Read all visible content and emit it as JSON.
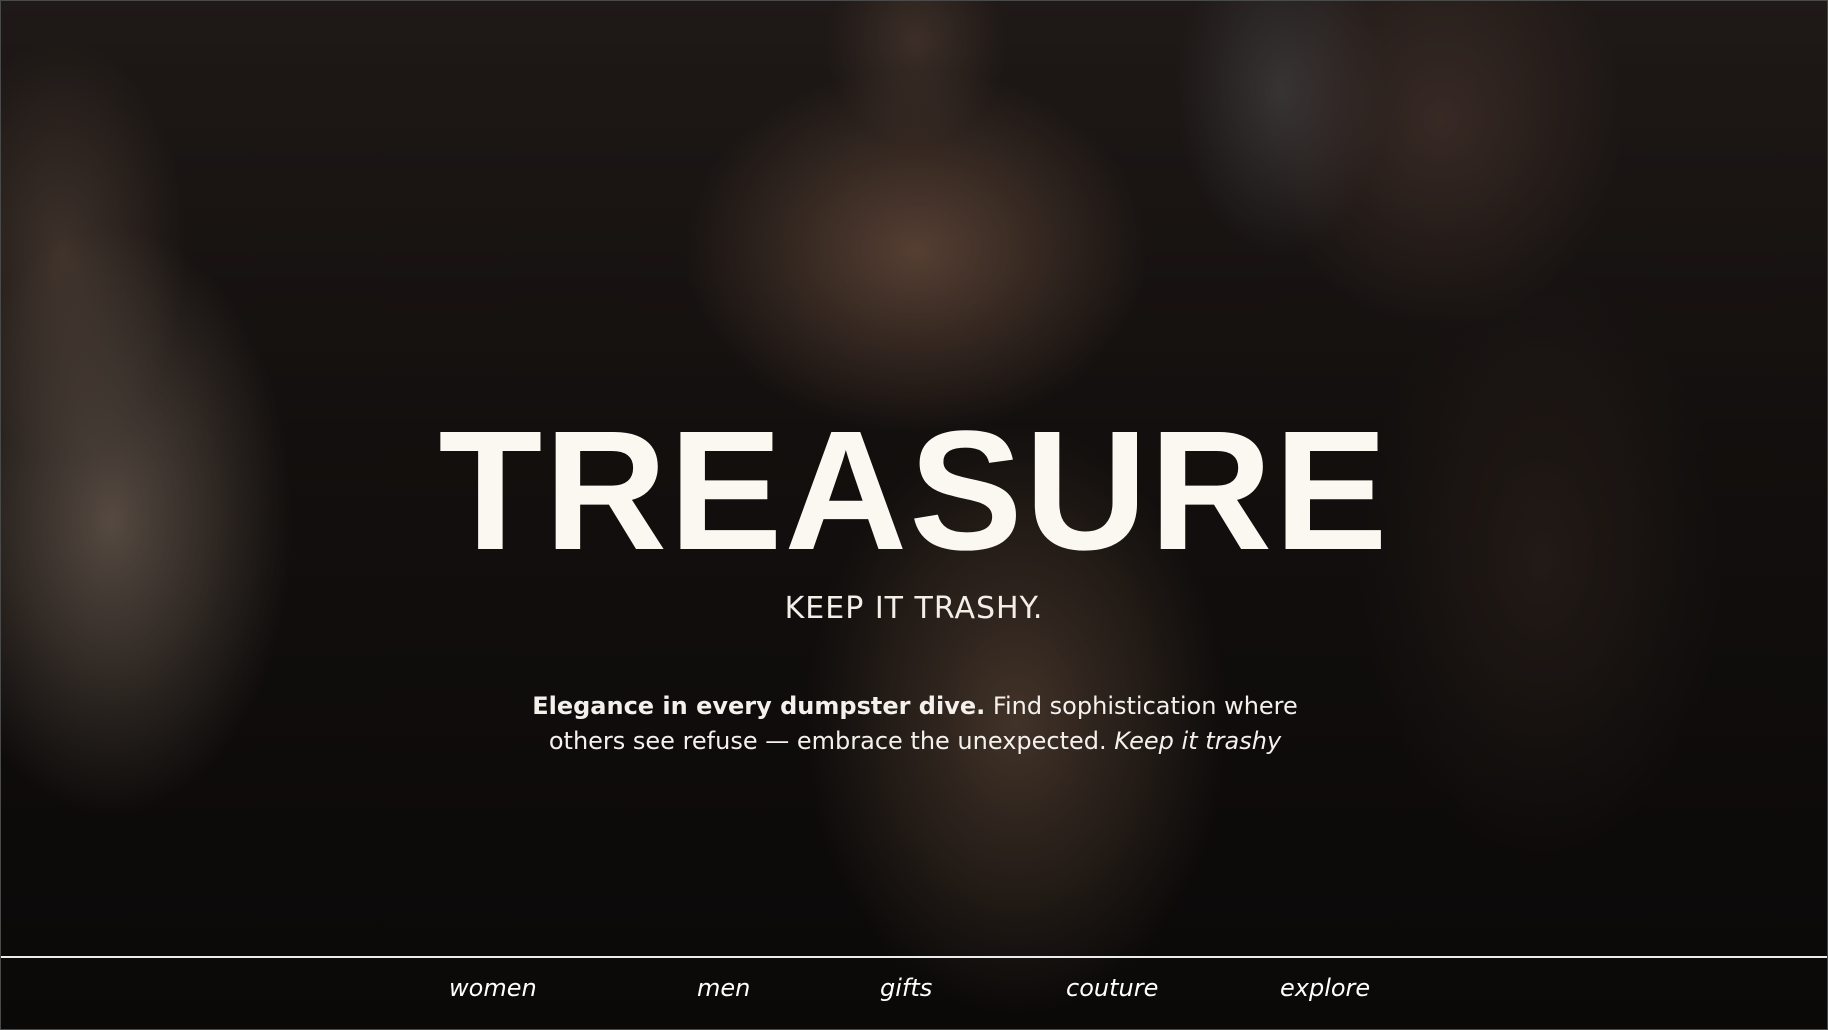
{
  "hero": {
    "title": "TREASURE",
    "tagline": "KEEP IT TRASHY.",
    "copy_bold": "Elegance in every dumpster dive.",
    "copy_rest": " Find sophistication where others see refuse — embrace the unexpected. ",
    "copy_italic": "Keep it trashy"
  },
  "nav": {
    "women": "women",
    "men": "men",
    "gifts": "gifts",
    "couture": "couture",
    "explore": "explore"
  },
  "colors": {
    "text": "#fbf7f1",
    "divider": "#ffffff"
  }
}
